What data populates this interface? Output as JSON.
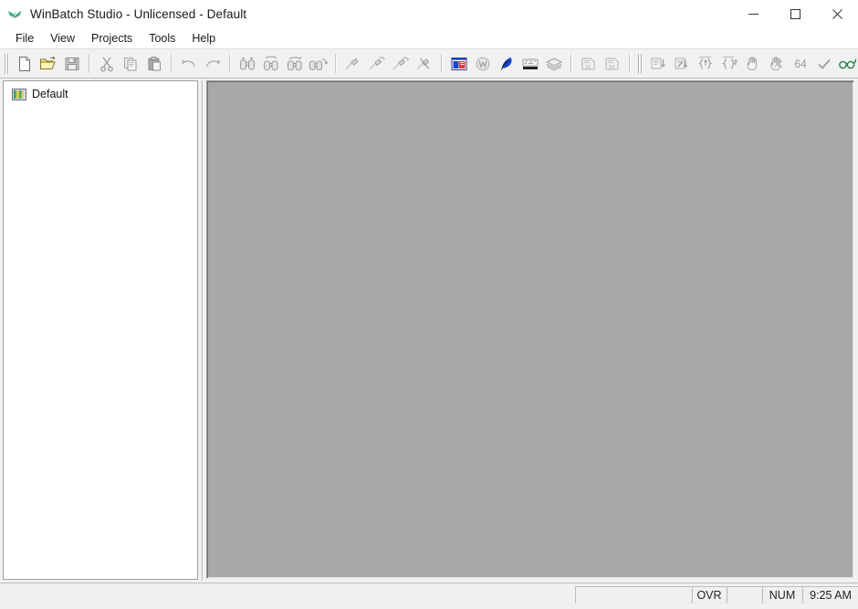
{
  "window": {
    "title": "WinBatch Studio - Unlicensed - Default",
    "logo_icon": "winbatch-bird-logo",
    "controls": [
      {
        "name": "minimize-button",
        "icon": "minimize-icon",
        "label": "Minimize"
      },
      {
        "name": "maximize-button",
        "icon": "maximize-icon",
        "label": "Maximize"
      },
      {
        "name": "close-button",
        "icon": "close-icon",
        "label": "Close"
      }
    ]
  },
  "menubar": {
    "items": [
      {
        "label": "File"
      },
      {
        "label": "View"
      },
      {
        "label": "Projects"
      },
      {
        "label": "Tools"
      },
      {
        "label": "Help"
      }
    ]
  },
  "toolbar": {
    "groups": [
      {
        "name": "file-group",
        "buttons": [
          {
            "icon": "new-file-icon",
            "label": "New",
            "enabled": true
          },
          {
            "icon": "open-folder-icon",
            "label": "Open",
            "enabled": true
          },
          {
            "icon": "save-disk-icon",
            "label": "Save",
            "enabled": false
          }
        ]
      },
      {
        "name": "clipboard-group",
        "buttons": [
          {
            "icon": "cut-scissors-icon",
            "label": "Cut",
            "enabled": false
          },
          {
            "icon": "copy-icon",
            "label": "Copy",
            "enabled": false
          },
          {
            "icon": "paste-icon",
            "label": "Paste",
            "enabled": false
          }
        ]
      },
      {
        "name": "history-group",
        "buttons": [
          {
            "icon": "undo-arrow-icon",
            "label": "Undo",
            "enabled": false
          },
          {
            "icon": "redo-arrow-icon",
            "label": "Redo",
            "enabled": false
          }
        ]
      },
      {
        "name": "find-group",
        "buttons": [
          {
            "icon": "find-binoculars-icon",
            "label": "Find",
            "enabled": false
          },
          {
            "icon": "find-next-binoculars-icon",
            "label": "Find Next",
            "enabled": false
          },
          {
            "icon": "find-previous-binoculars-icon",
            "label": "Find Previous",
            "enabled": false
          },
          {
            "icon": "replace-binoculars-icon",
            "label": "Replace",
            "enabled": false
          }
        ]
      },
      {
        "name": "bookmark-group",
        "buttons": [
          {
            "icon": "bookmark-toggle-icon",
            "label": "Toggle Bookmark",
            "enabled": false
          },
          {
            "icon": "bookmark-next-icon",
            "label": "Next Bookmark",
            "enabled": false
          },
          {
            "icon": "bookmark-previous-icon",
            "label": "Previous Bookmark",
            "enabled": false
          },
          {
            "icon": "bookmark-clear-icon",
            "label": "Clear Bookmarks",
            "enabled": false
          }
        ]
      },
      {
        "name": "tools-group",
        "buttons": [
          {
            "icon": "dialog-editor-icon",
            "label": "Dialog Editor",
            "enabled": true
          },
          {
            "icon": "word-doc-icon",
            "label": "Document",
            "enabled": false
          },
          {
            "icon": "pen-quill-icon",
            "label": "Edit",
            "enabled": true
          },
          {
            "icon": "keyboard-icon",
            "label": "Keyboard",
            "enabled": true
          },
          {
            "icon": "layers-icon",
            "label": "Layers",
            "enabled": true
          }
        ]
      },
      {
        "name": "compile-group",
        "buttons": [
          {
            "icon": "compile-32-icon",
            "label": "Compile 32-bit",
            "enabled": false
          },
          {
            "icon": "compile-64-icon",
            "label": "Compile 64-bit",
            "enabled": false
          }
        ]
      },
      {
        "name": "debug-group",
        "buttons": [
          {
            "icon": "step-into-icon",
            "label": "Step Into",
            "enabled": false
          },
          {
            "icon": "step-over-icon",
            "label": "Step Over",
            "enabled": false
          },
          {
            "icon": "run-braces-icon",
            "label": "Run",
            "enabled": false
          },
          {
            "icon": "exit-braces-icon",
            "label": "Step Out",
            "enabled": false
          },
          {
            "icon": "hand-stop-icon",
            "label": "Break",
            "enabled": false
          },
          {
            "icon": "hand-spider-icon",
            "label": "Debug",
            "enabled": false
          }
        ]
      },
      {
        "name": "check-group",
        "buttons": [
          {
            "icon": "bitness-label",
            "label": "64",
            "enabled": false,
            "is_text": true
          },
          {
            "icon": "checkmark-icon",
            "label": "Check Syntax",
            "enabled": false
          },
          {
            "icon": "glasses-icon",
            "label": "View",
            "enabled": true
          }
        ]
      }
    ]
  },
  "sidebar": {
    "name": "project-tree",
    "nodes": [
      {
        "label": "Default",
        "icon": "project-book-icon"
      }
    ]
  },
  "editor": {
    "name": "mdi-client-area",
    "background": "#a8a8a8",
    "content": ""
  },
  "statusbar": {
    "panes": [
      {
        "name": "status-message-pane",
        "text": ""
      },
      {
        "name": "status-progress-pane",
        "text": ""
      },
      {
        "name": "overwrite-indicator",
        "text": "OVR"
      },
      {
        "name": "caps-indicator",
        "text": ""
      },
      {
        "name": "numlock-indicator",
        "text": "NUM"
      },
      {
        "name": "clock-indicator",
        "text": "9:25 AM"
      }
    ]
  },
  "colors": {
    "accent_blue": "#1646c8",
    "logo_teal": "#3aa08a",
    "glasses_green": "#1f7a4d",
    "mdi_gray": "#a8a8a8",
    "chrome": "#f0f0f0"
  }
}
